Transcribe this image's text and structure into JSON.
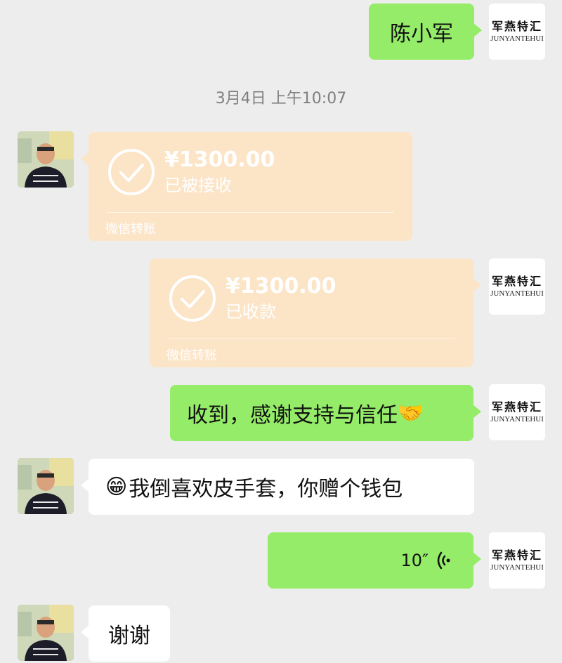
{
  "brand": {
    "name_cn": "军燕特汇",
    "name_en": "JUNYANTEHUI"
  },
  "messages": {
    "m1": {
      "text": "陈小军"
    },
    "timestamp": "3月4日 上午10:07",
    "transfer_received": {
      "amount": "¥1300.00",
      "status": "已被接收",
      "footer": "微信转账"
    },
    "transfer_collected": {
      "amount": "¥1300.00",
      "status": "已收款",
      "footer": "微信转账"
    },
    "m4": {
      "text": "收到，感谢支持与信任",
      "emoji": "🤝"
    },
    "m5": {
      "emoji": "😁",
      "text": "我倒喜欢皮手套，你赠个钱包"
    },
    "m6": {
      "duration": "10″",
      "icon": "voice-wave-icon"
    },
    "m7": {
      "text": "谢谢"
    }
  },
  "colors": {
    "background": "#ededed",
    "sent_bubble": "#95ec69",
    "received_bubble": "#ffffff",
    "transfer_card": "#fce4c7"
  }
}
